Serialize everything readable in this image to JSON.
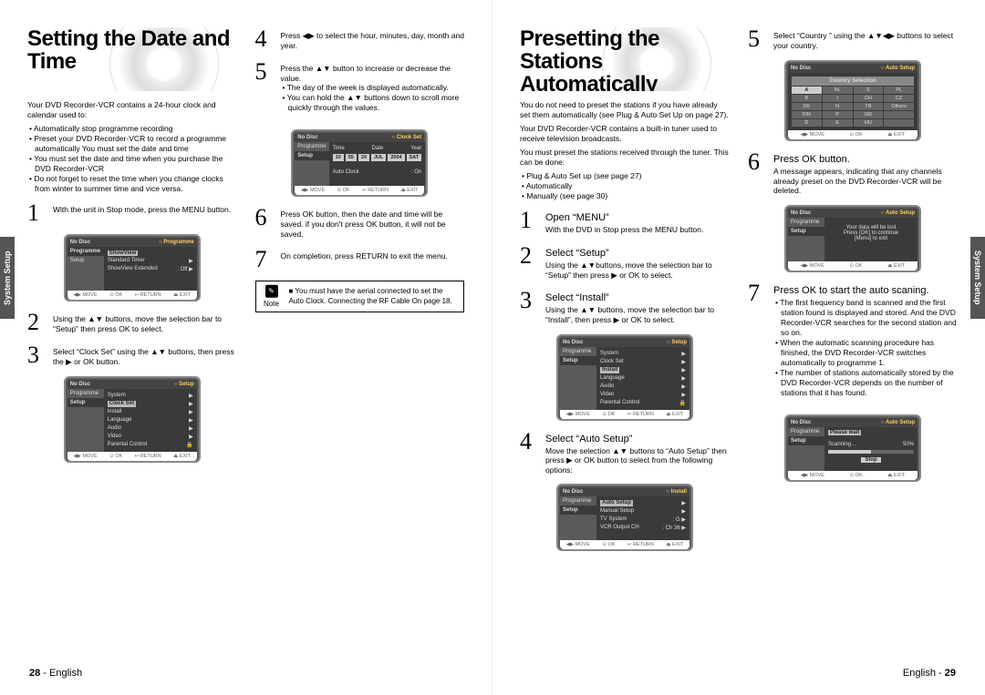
{
  "sideTab": "System Setup",
  "left": {
    "title": "Setting the Date and Time",
    "intro": "Your DVD Recorder-VCR contains a 24-hour clock and calendar used to:",
    "bullets": [
      "Automatically stop programme recording",
      "Preset your DVD Recorder-VCR to record a programme automatically You must set the date and time",
      "You must set the date and time when you purchase the DVD Recorder-VCR",
      "Do not forget to reset the time when you change clocks from winter to summer time and vice versa."
    ],
    "steps": {
      "s1": {
        "text": "With the unit in Stop mode, press the MENU button."
      },
      "s2": {
        "text": "Using the ▲▼ buttons, move the selection bar to “Setup” then press OK to select."
      },
      "s3": {
        "text": "Select “Clock Set” using the ▲▼ buttons, then press the ▶ or OK button."
      },
      "s4": {
        "text": "Press ◀▶ to select the hour, minutes, day, month and year."
      },
      "s5": {
        "text": "Press the ▲▼ button to increase or decrease the value.",
        "sub": [
          "The day of the week is displayed automatically.",
          "You can hold the ▲▼ buttons down to scroll more quickly through the values."
        ]
      },
      "s6": {
        "text": "Press OK button, then the date and time will be saved. if you don't press OK button, it will not be saved."
      },
      "s7": {
        "text": "On completion, press RETURN to exit the menu."
      }
    },
    "note": {
      "label": "Note",
      "text": "You must have the aerial connected to set the Auto Clock. Connecting the RF Cable On page 18."
    },
    "osd1": {
      "topL": "No Disc",
      "topR": "Programme",
      "navItems": [
        "Programme",
        "Setup"
      ],
      "navSel": 0,
      "rows": [
        [
          "ShowView",
          ""
        ],
        [
          "Standard Timer",
          "▶"
        ],
        [
          "ShowView Extended",
          ": Off   ▶"
        ]
      ]
    },
    "osd2": {
      "topL": "No Disc",
      "topR": "Setup",
      "navItems": [
        "Programme",
        "Setup"
      ],
      "navSel": 1,
      "rows": [
        [
          "System",
          "▶"
        ],
        [
          "Clock Set",
          "▶"
        ],
        [
          "Install",
          "▶"
        ],
        [
          "Language",
          "▶"
        ],
        [
          "Audio",
          "▶"
        ],
        [
          "Video",
          "▶"
        ],
        [
          "Parental Control",
          "🔒"
        ]
      ],
      "highlight": "Clock Set"
    },
    "osd3": {
      "topL": "No Disc",
      "topR": "Clock Set",
      "navItems": [
        "Programme",
        "Setup"
      ],
      "navSel": 1,
      "headers": [
        "Time",
        "Date",
        "Year"
      ],
      "cells": [
        "10",
        "55",
        "24",
        "JUL",
        "2004",
        "SAT"
      ],
      "extra": [
        [
          "Auto Clock",
          ": On"
        ]
      ]
    },
    "osdFooter": [
      "◀▶ MOVE",
      "⊙ OK",
      "↩ RETURN",
      "⏏ EXIT"
    ],
    "pageFooter": {
      "num": "28",
      "lang": "English"
    }
  },
  "right": {
    "title": "Presetting the Stations Automatically",
    "intro1": "You do not need to preset the stations if you have already set them automatically (see Plug & Auto Set Up on page 27).",
    "intro2": "Your DVD Recorder-VCR contains a built-in tuner used to receive television broadcasts.",
    "intro3": "You must preset the stations received through the tuner. This can be done:",
    "bullets": [
      "Plug & Auto Set up (see page 27)",
      "Automatically",
      "Manually  (see page 30)"
    ],
    "steps": {
      "s1": {
        "title": "Open “MENU”",
        "text": "With the DVD in Stop press the MENU button."
      },
      "s2": {
        "title": "Select “Setup”",
        "text": "Using the ▲▼buttons, move the selection bar to “Setup” then press ▶ or OK  to select."
      },
      "s3": {
        "title": "Select “Install”",
        "text": "Using the ▲▼ buttons, move the selection bar to “Install”, then press ▶ or OK  to select."
      },
      "s4": {
        "title": "Select “Auto Setup”",
        "text": "Move the selection ▲▼ buttons to “Auto Setup” then press ▶ or OK  button to select from the following options:"
      },
      "s5": {
        "text": "Select “Country ” using the ▲▼◀▶ buttons to select your country."
      },
      "s6": {
        "title": "Press OK  button.",
        "text": "A message appears, indicating that any channels already preset on the DVD Recorder-VCR will be deleted."
      },
      "s7": {
        "title": "Press OK to start the auto scaning.",
        "sub": [
          "The first frequency band is scanned and the first station found  is displayed and stored. And the DVD Recorder-VCR searches for the second station and so on.",
          "When the automatic scanning procedure has finished, the DVD Recorder-VCR switches automatically to programme 1.",
          "The number of stations automatically stored by the DVD Recorder-VCR depends on the number of stations that it has found."
        ]
      }
    },
    "osdSetup": {
      "topL": "No Disc",
      "topR": "Setup",
      "navItems": [
        "Programme",
        "Setup"
      ],
      "navSel": 1,
      "rows": [
        [
          "System",
          "▶"
        ],
        [
          "Clock Set",
          "▶"
        ],
        [
          "Install",
          "▶"
        ],
        [
          "Language",
          "▶"
        ],
        [
          "Audio",
          "▶"
        ],
        [
          "Video",
          "▶"
        ],
        [
          "Parental Control",
          "🔒"
        ]
      ],
      "highlight": "Install"
    },
    "osdInstall": {
      "topL": "No Disc",
      "topR": "Install",
      "navItems": [
        "Programme",
        "Setup"
      ],
      "navSel": 1,
      "rows": [
        [
          "Auto Setup",
          "▶"
        ],
        [
          "Manual Setup",
          "▶"
        ],
        [
          "TV System",
          ": G     ▶"
        ],
        [
          "VCR Output CH",
          ": Ch 36 ▶"
        ]
      ],
      "highlight": "Auto Setup"
    },
    "osdCountry": {
      "topL": "No Disc",
      "topR": "Auto Setup",
      "title": "Country Selection",
      "cells": [
        "A",
        "NL",
        "S",
        "PL",
        "B",
        "I",
        "CH",
        "CZ",
        "DK",
        "N",
        "TR",
        "Others",
        "FIN",
        "P",
        "GR",
        "",
        "D",
        "E",
        "HU",
        ""
      ],
      "selected": "A"
    },
    "osdWarn": {
      "topL": "No Disc",
      "topR": "Auto Setup",
      "navItems": [
        "Programme",
        "Setup"
      ],
      "lines": [
        "Your data will be lost",
        "Press [OK] to continue",
        "[Menu] to exit"
      ]
    },
    "osdScan": {
      "topL": "No Disc",
      "topR": "Auto Setup",
      "navItems": [
        "Programme",
        "Setup"
      ],
      "wait": "Please wait",
      "scanLabel": "Scanning...",
      "scanPct": "50%",
      "stop": "Stop"
    },
    "osdFooterShort": [
      "◀▶ MOVE",
      "⊙ OK",
      "⏏ EXIT"
    ],
    "pageFooter": {
      "lang": "English",
      "num": "29"
    }
  }
}
